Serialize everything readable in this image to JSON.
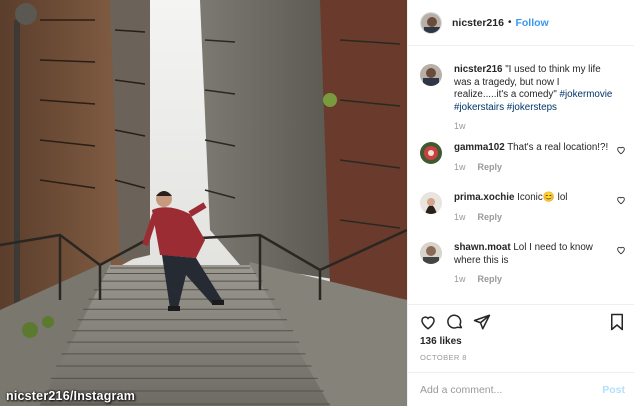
{
  "post": {
    "username": "nicster216",
    "separator": "•",
    "follow_label": "Follow",
    "watermark": "nicster216/Instagram"
  },
  "caption": {
    "username": "nicster216",
    "text": " \"I used to think my life was a tragedy, but now I realize.....it's a comedy\" ",
    "hashtags": "#jokermovie #jokerstairs #jokersteps",
    "time": "1w"
  },
  "comments": [
    {
      "username": "gamma102",
      "text": " That's a real location!?!",
      "time": "1w",
      "reply_label": "Reply"
    },
    {
      "username": "prima.xochie",
      "text": " Iconic😊 lol",
      "time": "1w",
      "reply_label": "Reply"
    },
    {
      "username": "shawn.moat",
      "text": " Lol I need to know where this is",
      "time": "1w",
      "reply_label": "Reply"
    }
  ],
  "likes": "136 likes",
  "date": "OCTOBER 8",
  "composer": {
    "placeholder": "Add a comment...",
    "post_label": "Post"
  },
  "icons": [
    "heart-icon",
    "comment-icon",
    "share-icon",
    "bookmark-icon"
  ],
  "colors": {
    "link": "#3897f0",
    "muted": "#999999",
    "text": "#262626",
    "post_disabled": "#b2dffc"
  }
}
